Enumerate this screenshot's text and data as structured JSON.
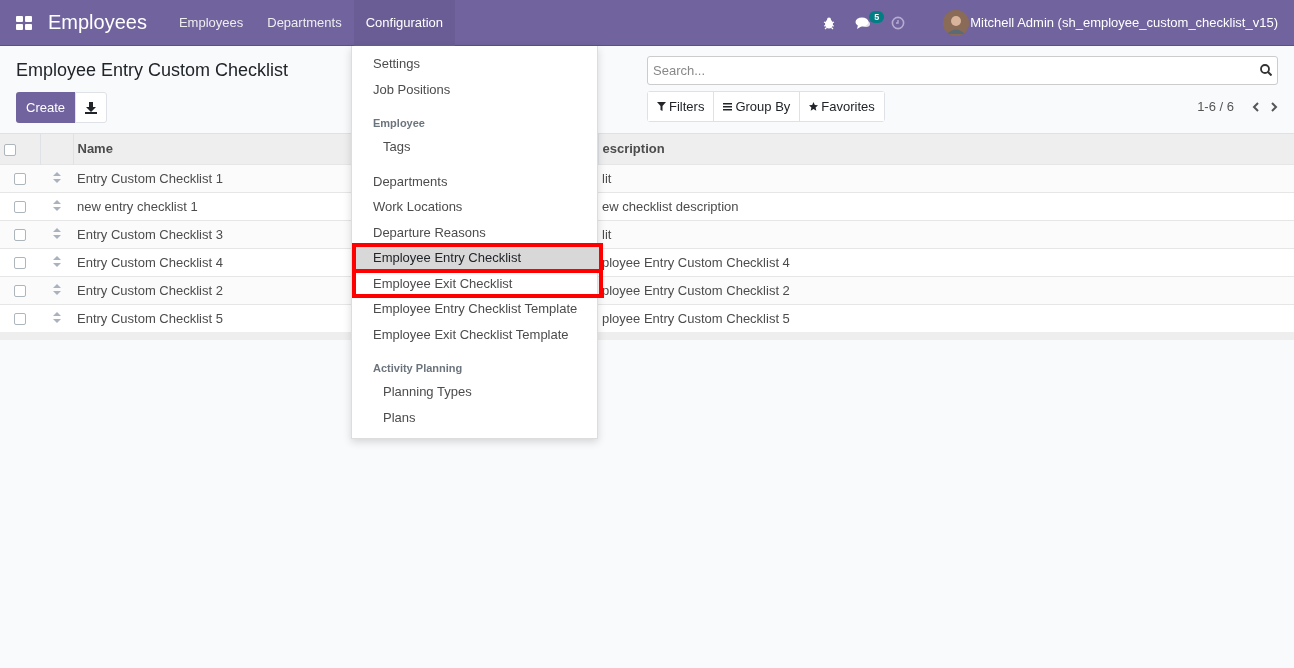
{
  "navbar": {
    "app_name": "Employees",
    "menus": [
      {
        "label": "Employees",
        "open": false
      },
      {
        "label": "Departments",
        "open": false
      },
      {
        "label": "Configuration",
        "open": true
      }
    ],
    "message_count": "5",
    "user": "Mitchell Admin (sh_employee_custom_checklist_v15)"
  },
  "config_menu": {
    "sections": [
      {
        "items": [
          {
            "label": "Settings",
            "selected": false,
            "outlined": false
          },
          {
            "label": "Job Positions",
            "selected": false,
            "outlined": false
          }
        ]
      },
      {
        "header": "Employee",
        "items": [
          {
            "label": "Tags",
            "selected": false,
            "outlined": false
          }
        ]
      },
      {
        "items": [
          {
            "label": "Departments",
            "selected": false,
            "outlined": false
          },
          {
            "label": "Work Locations",
            "selected": false,
            "outlined": false
          },
          {
            "label": "Departure Reasons",
            "selected": false,
            "outlined": false
          },
          {
            "label": "Employee Entry Checklist",
            "selected": true,
            "outlined": true
          },
          {
            "label": "Employee Exit Checklist",
            "selected": false,
            "outlined": true
          },
          {
            "label": "Employee Entry Checklist Template",
            "selected": false,
            "outlined": false
          },
          {
            "label": "Employee Exit Checklist Template",
            "selected": false,
            "outlined": false
          }
        ]
      },
      {
        "header": "Activity Planning",
        "items": [
          {
            "label": "Planning Types",
            "selected": false,
            "outlined": false
          },
          {
            "label": "Plans",
            "selected": false,
            "outlined": false
          }
        ]
      }
    ]
  },
  "page_title": "Employee Entry Custom Checklist",
  "create_button": "Create",
  "search": {
    "placeholder": "Search..."
  },
  "filters": [
    "Filters",
    "Group By",
    "Favorites"
  ],
  "pager": "1-6 / 6",
  "table": {
    "select_all_checked": false,
    "columns": [
      "Name",
      "escription"
    ],
    "rows": [
      {
        "name": "Entry Custom Checklist 1",
        "description": "lit",
        "checked": false
      },
      {
        "name": "new entry checklist 1",
        "description": "ew checklist description",
        "checked": false
      },
      {
        "name": "Entry Custom Checklist 3",
        "description": "lit",
        "checked": false
      },
      {
        "name": "Entry Custom Checklist 4",
        "description": "ployee Entry Custom Checklist 4",
        "checked": false
      },
      {
        "name": "Entry Custom Checklist 2",
        "description": "ployee Entry Custom Checklist 2",
        "checked": false
      },
      {
        "name": "Entry Custom Checklist 5",
        "description": "ployee Entry Custom Checklist 5",
        "checked": false
      }
    ]
  }
}
